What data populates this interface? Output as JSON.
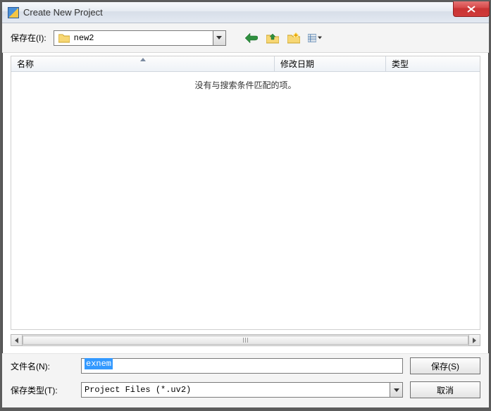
{
  "window": {
    "title": "Create New Project"
  },
  "toolbar": {
    "save_in_label": "保存在(I):",
    "folder_name": "new2",
    "icons": {
      "back": "back-arrow",
      "up": "folder-up",
      "new": "new-folder",
      "view": "views"
    }
  },
  "columns": {
    "name": "名称",
    "modified": "修改日期",
    "type": "类型"
  },
  "list": {
    "empty_message": "没有与搜索条件匹配的项。"
  },
  "bottom": {
    "filename_label": "文件名(N):",
    "filename_value": "exnem",
    "filetype_label": "保存类型(T):",
    "filetype_value": "Project Files (*.uv2)",
    "save_button": "保存(S)",
    "cancel_button": "取消"
  }
}
